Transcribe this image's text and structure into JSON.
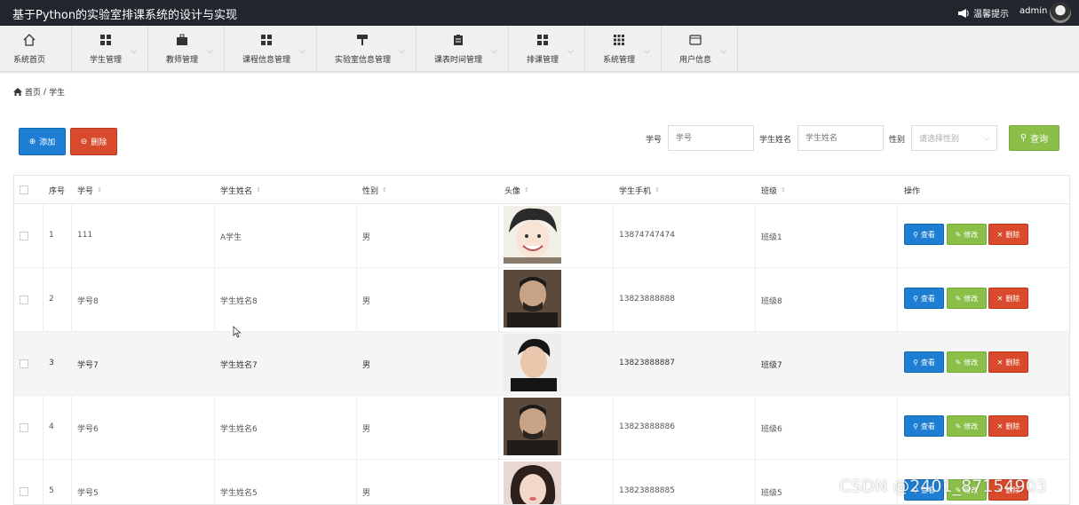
{
  "app": {
    "title": "基于Python的实验室排课系统的设计与实现",
    "notice_label": "温馨提示",
    "username": "admin"
  },
  "nav": {
    "home": "系统首页",
    "items": [
      "学生管理",
      "教师管理",
      "课程信息管理",
      "实验室信息管理",
      "课表时间管理",
      "排课管理",
      "系统管理",
      "用户信息"
    ]
  },
  "breadcrumb": {
    "home": "首页",
    "sep": "/",
    "current": "学生"
  },
  "toolbar": {
    "add_label": "添加",
    "delete_label": "删除"
  },
  "search": {
    "student_no_label": "学号",
    "student_no_placeholder": "学号",
    "student_name_label": "学生姓名",
    "student_name_placeholder": "学生姓名",
    "gender_label": "性别",
    "gender_placeholder": "请选择性别",
    "query_label": "查询"
  },
  "table": {
    "headers": {
      "index": "序号",
      "student_no": "学号",
      "name": "学生姓名",
      "gender": "性别",
      "avatar": "头像",
      "phone": "学生手机",
      "class": "班级",
      "actions": "操作"
    },
    "actions": {
      "view": "查看",
      "edit": "修改",
      "delete": "删除"
    },
    "rows": [
      {
        "index": "1",
        "student_no": "111",
        "name": "A学生",
        "gender": "男",
        "phone": "13874747474",
        "class": "班级1",
        "photo": "anime-boy"
      },
      {
        "index": "2",
        "student_no": "学号8",
        "name": "学生姓名8",
        "gender": "男",
        "phone": "13823888888",
        "class": "班级8",
        "photo": "man-dark"
      },
      {
        "index": "3",
        "student_no": "学号7",
        "name": "学生姓名7",
        "gender": "男",
        "phone": "13823888887",
        "class": "班级7",
        "photo": "young-man"
      },
      {
        "index": "4",
        "student_no": "学号6",
        "name": "学生姓名6",
        "gender": "男",
        "phone": "13823888886",
        "class": "班级6",
        "photo": "man-dark"
      },
      {
        "index": "5",
        "student_no": "学号5",
        "name": "学生姓名5",
        "gender": "男",
        "phone": "13823888885",
        "class": "班级5",
        "photo": "girl"
      }
    ]
  },
  "watermark": "CSDN @2401_87154903",
  "colors": {
    "topbar": "#23262e",
    "primary": "#1e7ed3",
    "danger": "#d9492b",
    "success": "#8bbf4a"
  }
}
